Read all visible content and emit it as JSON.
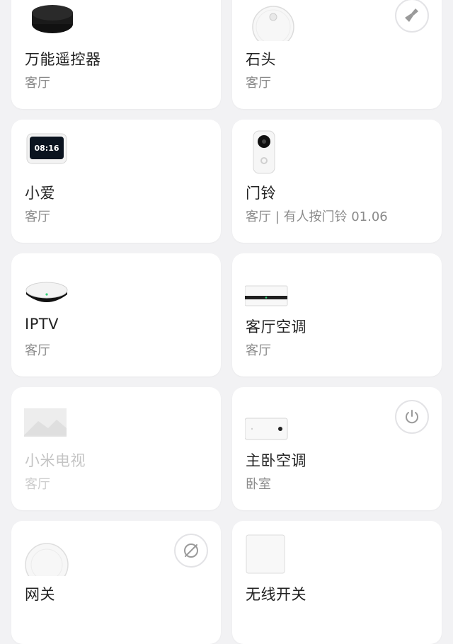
{
  "devices": [
    {
      "name": "万能遥控器",
      "room": "客厅",
      "icon": "remote-hub-icon"
    },
    {
      "name": "石头",
      "room": "客厅",
      "icon": "robot-vacuum-icon",
      "action_icon": "broom-icon"
    },
    {
      "name": "小爱",
      "room": "客厅",
      "icon": "smart-display-icon",
      "screen_time": "08:16"
    },
    {
      "name": "门铃",
      "room": "客厅 | 有人按门铃 01.06",
      "icon": "doorbell-icon"
    },
    {
      "name": "IPTV",
      "room": "客厅",
      "icon": "tv-box-icon"
    },
    {
      "name": "客厅空调",
      "room": "客厅",
      "icon": "air-conditioner-icon"
    },
    {
      "name": "小米电视",
      "room": "客厅",
      "icon": "television-icon",
      "status": "offline"
    },
    {
      "name": "主卧空调",
      "room": "卧室",
      "icon": "air-conditioner-icon",
      "action_icon": "power-icon"
    },
    {
      "name": "网关",
      "room": "",
      "icon": "gateway-icon",
      "action_icon": "disconnected-icon"
    },
    {
      "name": "无线开关",
      "room": "",
      "icon": "wireless-switch-icon"
    }
  ],
  "colors": {
    "background": "#f2f2f4",
    "card": "#ffffff",
    "title_text": "#222222",
    "subtitle_text": "#8a8a8a",
    "offline_text": "#c4c4c4"
  }
}
